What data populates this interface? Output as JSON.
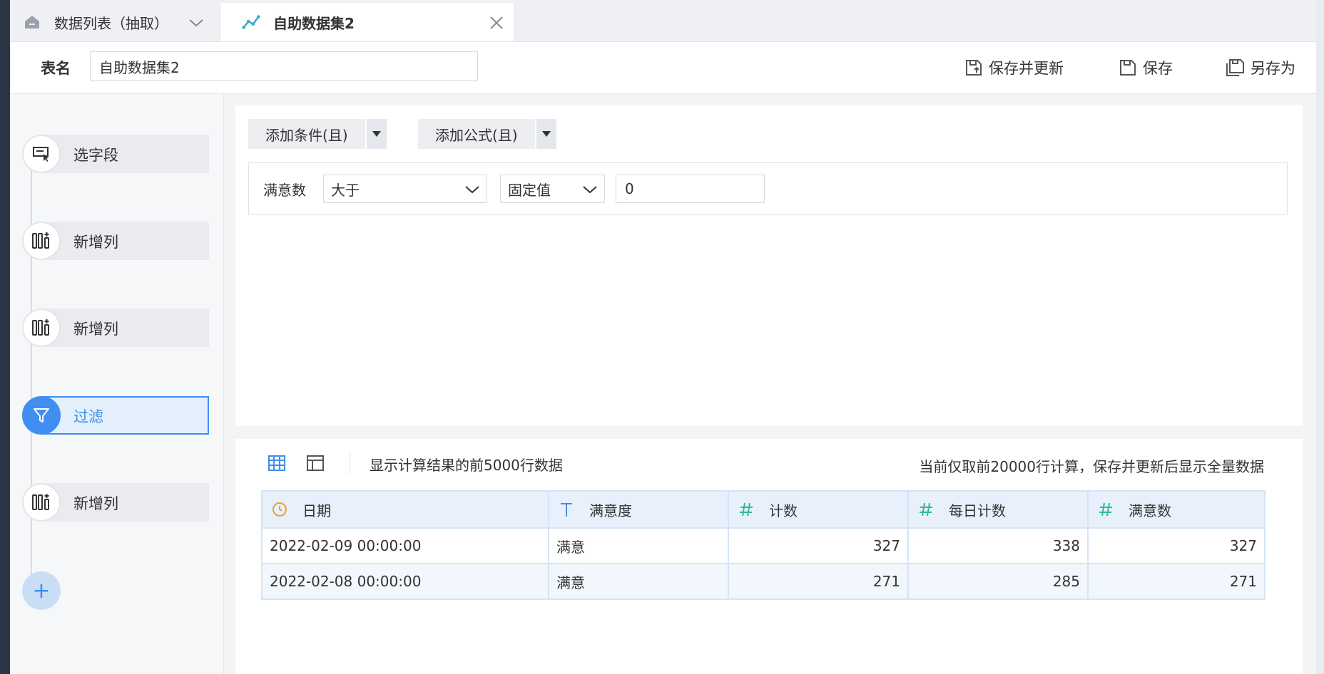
{
  "tabs": [
    {
      "label": "数据列表（抽取）",
      "icon": "home-icon"
    },
    {
      "label": "自助数据集2",
      "icon": "dataset-line-icon"
    }
  ],
  "header": {
    "name_label": "表名",
    "name_value": "自助数据集2",
    "buttons": {
      "save_update": "保存并更新",
      "save": "保存",
      "save_as": "另存为"
    }
  },
  "steps": [
    {
      "label": "选字段",
      "icon": "select-field-icon"
    },
    {
      "label": "新增列",
      "icon": "add-column-icon"
    },
    {
      "label": "新增列",
      "icon": "add-column-icon"
    },
    {
      "label": "过滤",
      "icon": "filter-icon",
      "active": true
    },
    {
      "label": "新增列",
      "icon": "add-column-icon"
    }
  ],
  "add_step_symbol": "+",
  "filter": {
    "add_condition": "添加条件(且)",
    "add_formula": "添加公式(且)",
    "condition": {
      "field": "满意数",
      "operator": "大于",
      "value_type": "固定值",
      "value": "0"
    }
  },
  "preview": {
    "note_left": "显示计算结果的前5000行数据",
    "note_right": "当前仅取前20000行计算，保存并更新后显示全量数据",
    "columns": [
      {
        "label": "日期",
        "type_icon": "clock-icon",
        "color": "#f0a030"
      },
      {
        "label": "满意度",
        "type_icon": "text-type-icon",
        "color": "#3f8ef0"
      },
      {
        "label": "计数",
        "type_icon": "number-type-icon",
        "color": "#2eb8a0"
      },
      {
        "label": "每日计数",
        "type_icon": "number-type-icon",
        "color": "#2eb8a0"
      },
      {
        "label": "满意数",
        "type_icon": "number-type-icon",
        "color": "#2eb8a0"
      }
    ],
    "rows": [
      [
        "2022-02-09 00:00:00",
        "满意",
        "327",
        "338",
        "327"
      ],
      [
        "2022-02-08 00:00:00",
        "满意",
        "271",
        "285",
        "271"
      ]
    ]
  },
  "colors": {
    "accent": "#3f8ef0",
    "sidebar_dark": "#2b3544",
    "date_type": "#f0a030",
    "number_type": "#2eb8a0"
  }
}
